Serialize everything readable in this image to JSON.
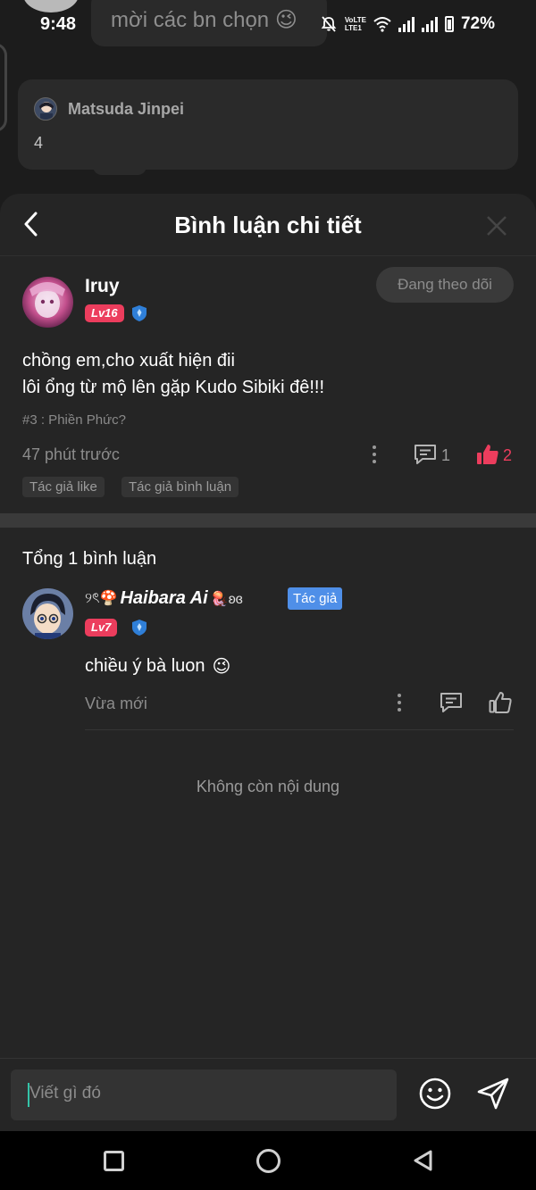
{
  "status_bar": {
    "time": "9:48",
    "battery": "72%",
    "network_label": "LTE1",
    "volte_label": "VoLTE"
  },
  "background_chat": {
    "top_message": "mời các bn chọn 😉",
    "card": {
      "author": "Matsuda Jinpei",
      "message": "4"
    }
  },
  "sheet": {
    "title": "Bình luận chi tiết"
  },
  "main_comment": {
    "username": "Iruy",
    "level": "Lv16",
    "follow_label": "Đang theo dõi",
    "text_line1": "chồng em,cho xuất hiện đii",
    "text_line2": "lôi ổng từ mộ lên gặp Kudo Sibiki đê!!!",
    "tag": "#3 : Phiền Phức?",
    "time": "47 phút trước",
    "reply_count": "1",
    "like_count": "2",
    "chips": [
      "Tác giả like",
      "Tác giả bình luận"
    ]
  },
  "replies": {
    "total_label": "Tổng 1 bình luận",
    "items": [
      {
        "prefix_deco": "୨ৎ🍄",
        "username": "Haibara Ai",
        "suffix_deco": "🪼ʚɞ",
        "author_badge": "Tác giả",
        "level": "Lv7",
        "text": "chiều ý bà luon",
        "emoji": "😉",
        "time": "Vừa mới"
      }
    ],
    "end_label": "Không còn nội dung"
  },
  "input": {
    "placeholder": "Viết gì đó"
  },
  "colors": {
    "accent_like": "#ec3d5d",
    "level_badge": "#ec3d5d",
    "author_badge": "#4f8fe8",
    "sheet_bg": "#252525",
    "caret": "#34c3a8"
  },
  "icons": [
    "back-icon",
    "close-icon",
    "more-icon",
    "reply-icon",
    "like-icon",
    "shield-icon",
    "emoji-icon",
    "send-icon",
    "mute-icon",
    "wifi-icon",
    "signal-icon",
    "battery-icon"
  ]
}
